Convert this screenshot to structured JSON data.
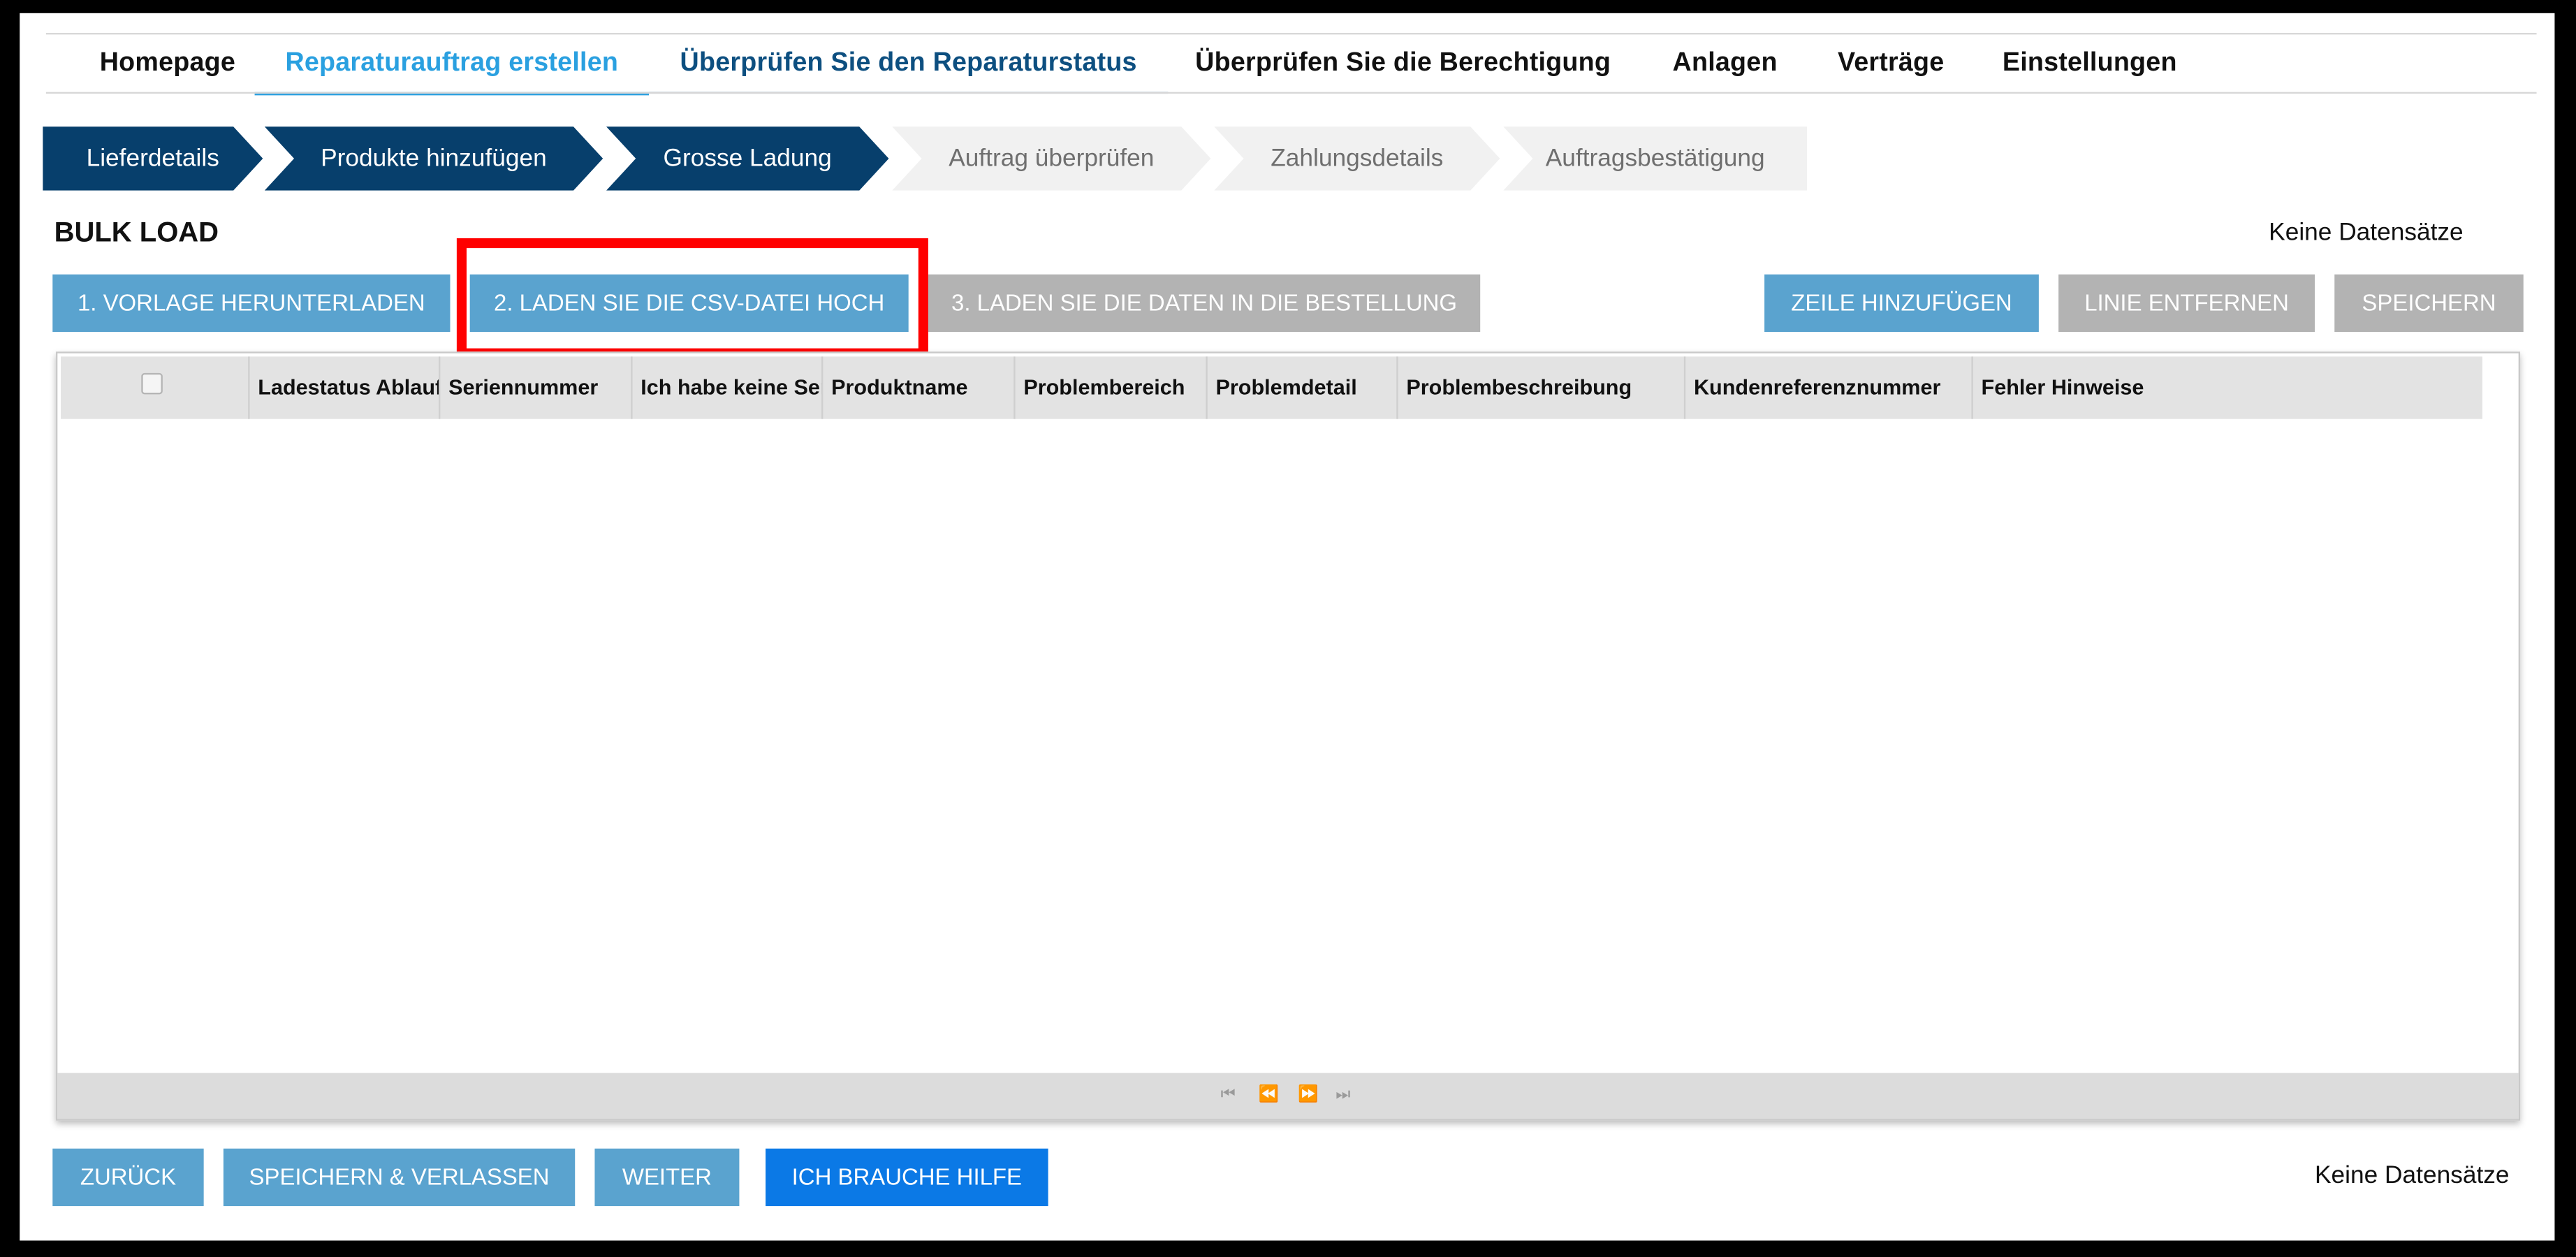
{
  "nav": {
    "items": [
      {
        "label": "Homepage",
        "state": "normal"
      },
      {
        "label": "Reparaturauftrag erstellen",
        "state": "active"
      },
      {
        "label": "Überprüfen Sie den Reparaturstatus",
        "state": "visited"
      },
      {
        "label": "Überprüfen Sie die Berechtigung",
        "state": "normal"
      },
      {
        "label": "Anlagen",
        "state": "normal"
      },
      {
        "label": "Verträge",
        "state": "normal"
      },
      {
        "label": "Einstellungen",
        "state": "normal"
      }
    ]
  },
  "steps": [
    {
      "label": "Lieferdetails",
      "status": "done"
    },
    {
      "label": "Produkte hinzufügen",
      "status": "done"
    },
    {
      "label": "Grosse Ladung",
      "status": "done"
    },
    {
      "label": "Auftrag überprüfen",
      "status": "todo"
    },
    {
      "label": "Zahlungsdetails",
      "status": "todo"
    },
    {
      "label": "Auftragsbestätigung",
      "status": "todo"
    }
  ],
  "page": {
    "title": "BULK LOAD",
    "records_top": "Keine Datensätze",
    "records_bottom": "Keine Datensätze"
  },
  "toolbar": {
    "download_template": "1. VORLAGE HERUNTERLADEN",
    "upload_csv": "2. LADEN SIE DIE CSV-DATEI HOCH",
    "load_data": "3. LADEN SIE DIE DATEN IN DIE BESTELLUNG",
    "add_row": "ZEILE HINZUFÜGEN",
    "remove_line": "LINIE ENTFERNEN",
    "save": "SPEICHERN"
  },
  "grid": {
    "columns": [
      "Ladestatus Ablauf",
      "Seriennummer",
      "Ich habe keine Seriennummer",
      "Produktname",
      "Problembereich",
      "Problemdetail",
      "Problembeschreibung",
      "Kundenreferenznummer",
      "Fehler Hinweise"
    ],
    "rows": [],
    "pager": {
      "first": "⏮",
      "prev": "⏪",
      "next": "⏩",
      "last": "⏭"
    }
  },
  "footer_buttons": {
    "back": "ZURÜCK",
    "save_exit": "SPEICHERN & VERLASSEN",
    "next": "WEITER",
    "help": "ICH BRAUCHE HILFE"
  },
  "colors": {
    "accent": "#2aa0e0",
    "step_done": "#073f6c",
    "button_blue": "#5aa3cf",
    "button_disabled": "#b3b3b3",
    "button_help": "#0b79e6",
    "highlight": "#ff0000"
  }
}
